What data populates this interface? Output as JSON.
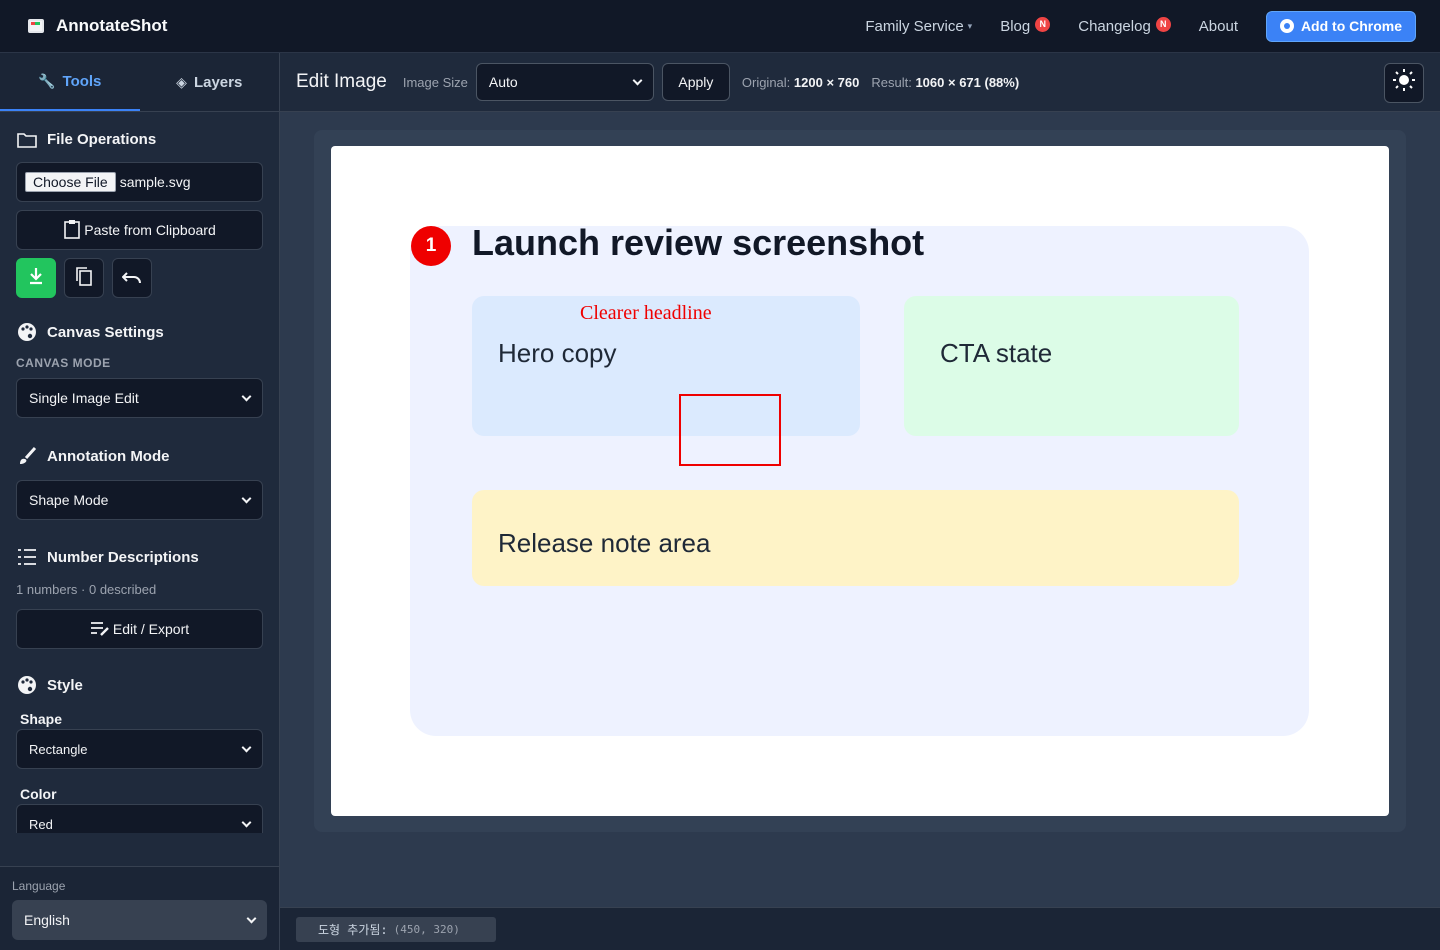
{
  "app": {
    "name": "AnnotateShot"
  },
  "nav": {
    "links": [
      {
        "label": "Family Service"
      },
      {
        "label": "Blog",
        "badge": "N"
      },
      {
        "label": "Changelog",
        "badge": "N"
      },
      {
        "label": "About"
      }
    ],
    "cta": "Add to Chrome"
  },
  "sidebar": {
    "tabs": {
      "tools": "Tools",
      "layers": "Layers"
    },
    "file_ops": {
      "title": "File Operations",
      "choose_label": "Choose File",
      "file_name": "sample.svg",
      "paste_label": "Paste from Clipboard"
    },
    "canvas_settings": {
      "title": "Canvas Settings",
      "mode_label": "CANVAS MODE",
      "mode_value": "Single Image Edit"
    },
    "annotation_mode": {
      "title": "Annotation Mode",
      "value": "Shape Mode"
    },
    "number_desc": {
      "title": "Number Descriptions",
      "summary": "1 numbers · 0 described",
      "edit_label": "Edit / Export"
    },
    "style": {
      "title": "Style",
      "shape_label": "Shape",
      "shape_value": "Rectangle",
      "color_label": "Color",
      "color_value": "Red"
    },
    "language": {
      "label": "Language",
      "value": "English"
    }
  },
  "toolbar": {
    "title": "Edit Image",
    "size_label": "Image Size",
    "size_value": "Auto",
    "apply_label": "Apply",
    "original_label": "Original:",
    "original_value": "1200 × 760",
    "result_label": "Result:",
    "result_value": "1060 × 671 (88%)"
  },
  "canvas": {
    "title": "Launch review screenshot",
    "badge_number": "1",
    "cards": {
      "hero": "Hero copy",
      "cta": "CTA state",
      "release": "Release note area"
    },
    "annotation_text": "Clearer headline"
  },
  "status": {
    "message": "도형 추가됨:",
    "coords": "(450, 320)"
  },
  "colors": {
    "accent": "#3b82f6",
    "annotation": "#ef0000",
    "success": "#22c55e"
  }
}
